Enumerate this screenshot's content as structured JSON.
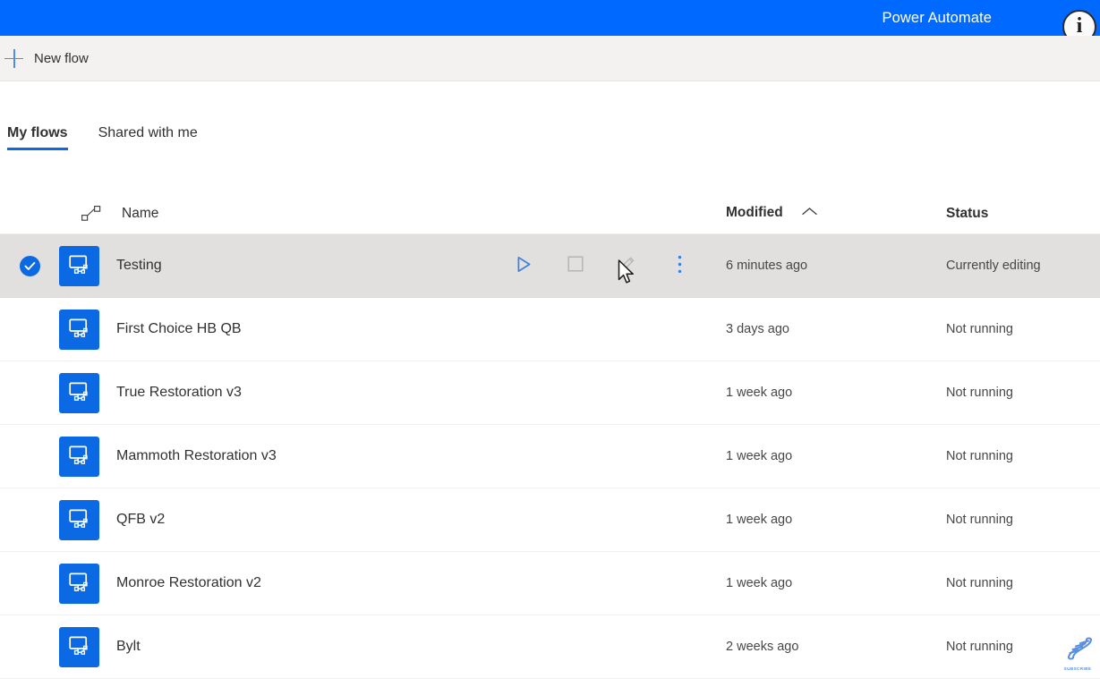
{
  "topbar": {
    "title": "Power Automate",
    "info_icon_label": "i",
    "accent_blue": "#0069ff"
  },
  "commandbar": {
    "new_flow_label": "New flow",
    "plus_icon": "plus-icon"
  },
  "tabs": [
    {
      "label": "My flows",
      "active": true
    },
    {
      "label": "Shared with me",
      "active": false
    }
  ],
  "table": {
    "headers": {
      "type_icon": "flow-connector-icon",
      "name": "Name",
      "modified": "Modified",
      "modified_sort": "ascending",
      "status": "Status"
    },
    "row_actions": {
      "run": "run-icon",
      "stop": "stop-icon",
      "edit": "edit-icon",
      "more": "more-options-icon"
    },
    "rows": [
      {
        "name": "Testing",
        "modified": "6 minutes ago",
        "status": "Currently editing",
        "selected": true,
        "icon": "desktop-flow-icon"
      },
      {
        "name": "First Choice HB QB",
        "modified": "3 days ago",
        "status": "Not running",
        "selected": false,
        "icon": "desktop-flow-icon"
      },
      {
        "name": "True Restoration v3",
        "modified": "1 week ago",
        "status": "Not running",
        "selected": false,
        "icon": "desktop-flow-icon"
      },
      {
        "name": "Mammoth Restoration v3",
        "modified": "1 week ago",
        "status": "Not running",
        "selected": false,
        "icon": "desktop-flow-icon"
      },
      {
        "name": "QFB v2",
        "modified": "1 week ago",
        "status": "Not running",
        "selected": false,
        "icon": "desktop-flow-icon"
      },
      {
        "name": "Monroe Restoration v2",
        "modified": "1 week ago",
        "status": "Not running",
        "selected": false,
        "icon": "desktop-flow-icon"
      },
      {
        "name": "Bylt",
        "modified": "2 weeks ago",
        "status": "Not running",
        "selected": false,
        "icon": "desktop-flow-icon"
      }
    ]
  },
  "watermark": {
    "label": "SUBSCRIBE",
    "icon": "dna-helix-icon",
    "color": "#5b8fe0"
  },
  "cursor": {
    "icon": "arrow-pointer-cursor"
  }
}
